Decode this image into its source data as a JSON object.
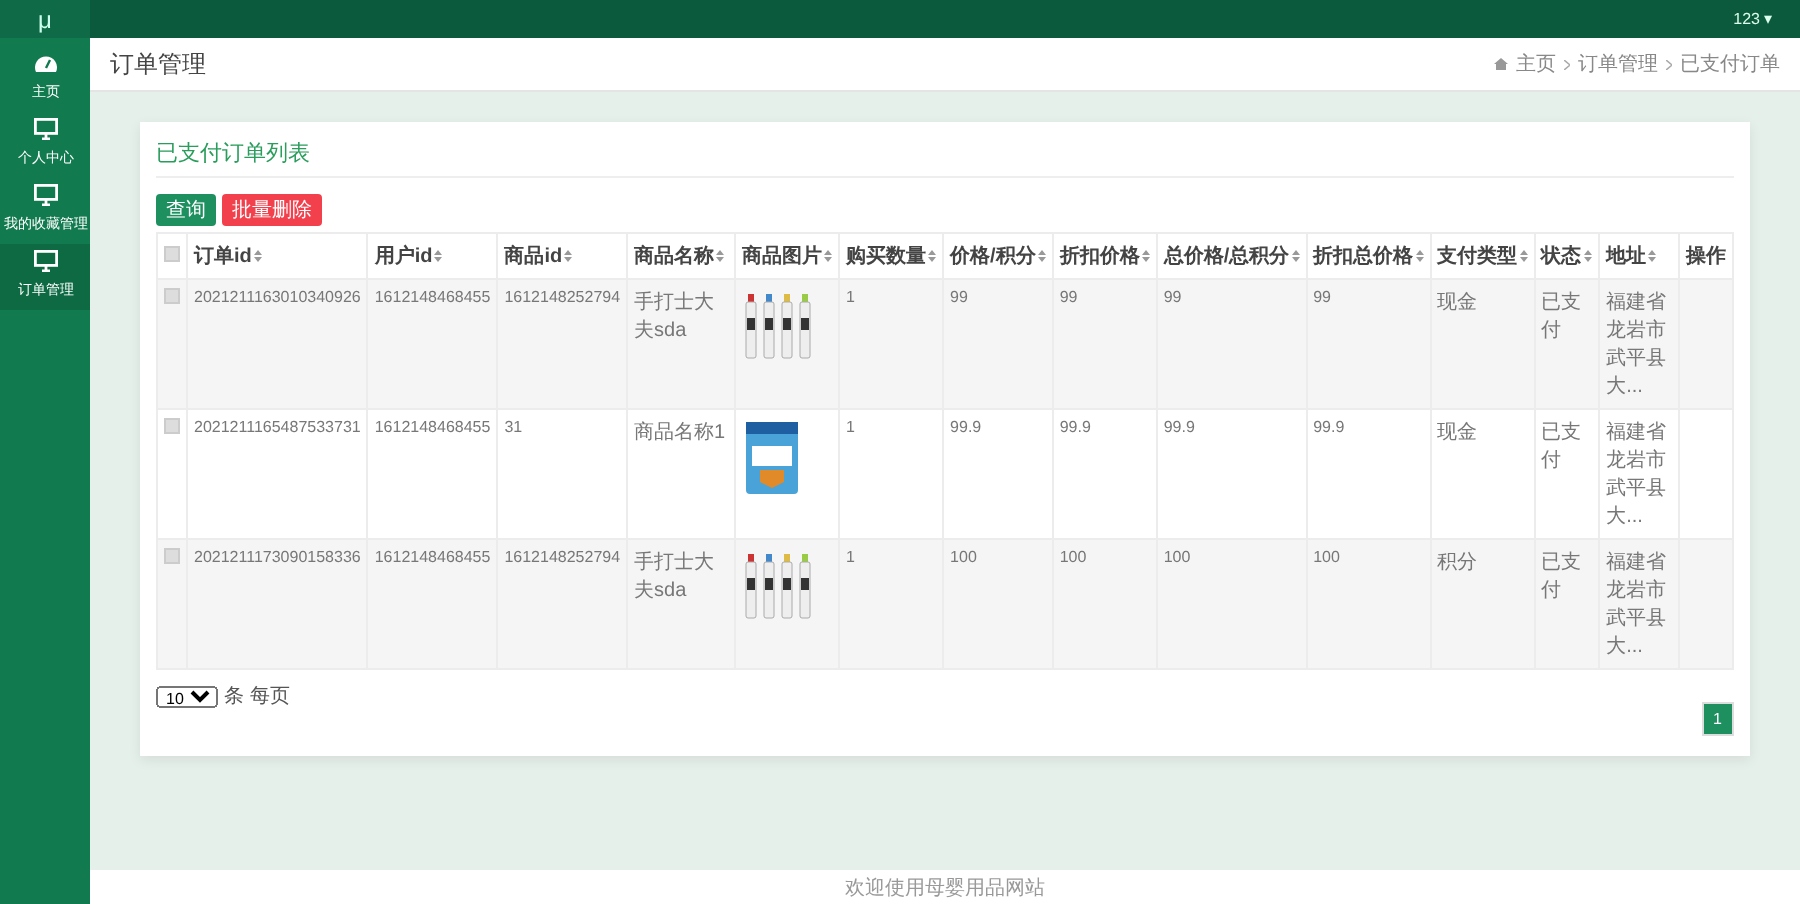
{
  "topbar": {
    "logo": "μ",
    "user": "123",
    "caret": "▾"
  },
  "sidebar": {
    "items": [
      {
        "label": "主页",
        "kind": "dashboard",
        "selected": false
      },
      {
        "label": "个人中心",
        "kind": "monitor",
        "selected": false
      },
      {
        "label": "我的收藏管理",
        "kind": "monitor",
        "selected": false
      },
      {
        "label": "订单管理",
        "kind": "monitor",
        "selected": true
      }
    ]
  },
  "page_title": "订单管理",
  "breadcrumb": [
    "主页",
    "订单管理",
    "已支付订单"
  ],
  "card": {
    "title": "已支付订单列表",
    "buttons": [
      {
        "label": "查询",
        "kind": "primary"
      },
      {
        "label": "批量删除",
        "kind": "danger"
      }
    ],
    "table": {
      "header_checked": false,
      "columns": [
        {
          "label": "订单id",
          "sortable": true
        },
        {
          "label": "用户id",
          "sortable": true
        },
        {
          "label": "商品id",
          "sortable": true
        },
        {
          "label": "商品名称",
          "sortable": true
        },
        {
          "label": "商品图片",
          "sortable": true
        },
        {
          "label": "购买数量",
          "sortable": true
        },
        {
          "label": "价格/积分",
          "sortable": true
        },
        {
          "label": "折扣价格",
          "sortable": true
        },
        {
          "label": "总价格/总积分",
          "sortable": true
        },
        {
          "label": "折扣总价格",
          "sortable": true
        },
        {
          "label": "支付类型",
          "sortable": true
        },
        {
          "label": "状态",
          "sortable": true
        },
        {
          "label": "地址",
          "sortable": true
        },
        {
          "label": "操作",
          "sortable": false
        }
      ],
      "rows": [
        {
          "checked": false,
          "cells": [
            {
              "text": "2021211163010340926"
            },
            {
              "text": "1612148468455"
            },
            {
              "text": "1612148252794"
            },
            {
              "text": "手打士大夫sda"
            },
            {
              "kind": "bottles"
            },
            {
              "text": "1"
            },
            {
              "text": "99"
            },
            {
              "text": "99"
            },
            {
              "text": "99"
            },
            {
              "text": "99"
            },
            {
              "text": "现金"
            },
            {
              "text": "已支付"
            },
            {
              "text": "福建省龙岩市武平县大..."
            }
          ]
        },
        {
          "checked": false,
          "cells": [
            {
              "text": "2021211165487533731"
            },
            {
              "text": "1612148468455"
            },
            {
              "text": "31"
            },
            {
              "text": "商品名称1"
            },
            {
              "kind": "can"
            },
            {
              "text": "1"
            },
            {
              "text": "99.9"
            },
            {
              "text": "99.9"
            },
            {
              "text": "99.9"
            },
            {
              "text": "99.9"
            },
            {
              "text": "现金"
            },
            {
              "text": "已支付"
            },
            {
              "text": "福建省龙岩市武平县大..."
            }
          ]
        },
        {
          "checked": false,
          "cells": [
            {
              "text": "2021211173090158336"
            },
            {
              "text": "1612148468455"
            },
            {
              "text": "1612148252794"
            },
            {
              "text": "手打士大夫sda"
            },
            {
              "kind": "bottles"
            },
            {
              "text": "1"
            },
            {
              "text": "100"
            },
            {
              "text": "100"
            },
            {
              "text": "100"
            },
            {
              "text": "100"
            },
            {
              "text": "积分"
            },
            {
              "text": "已支付"
            },
            {
              "text": "福建省龙岩市武平县大..."
            }
          ]
        }
      ]
    },
    "page_size": "10",
    "page_size_label": "条 每页",
    "pages": [
      {
        "label": "1",
        "selected": true
      }
    ]
  },
  "footer": "欢迎使用母婴用品网站"
}
